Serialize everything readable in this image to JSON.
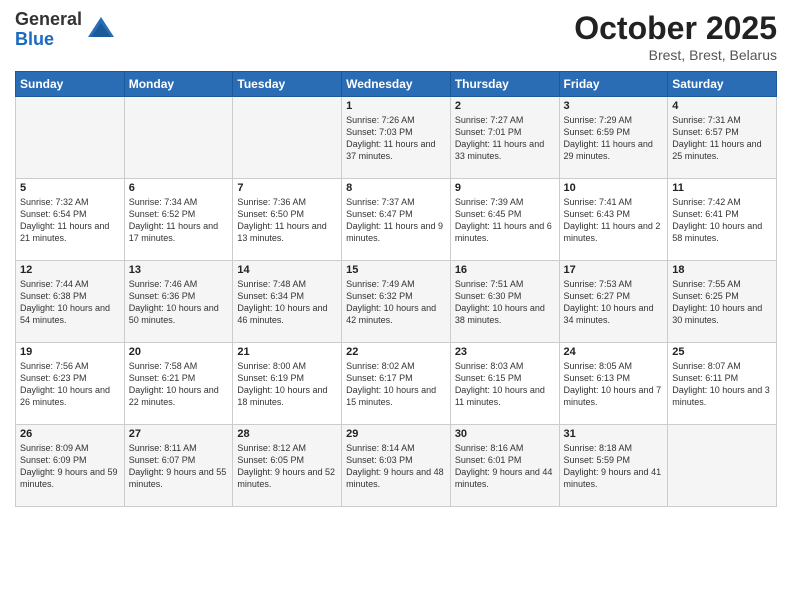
{
  "logo": {
    "general": "General",
    "blue": "Blue"
  },
  "title": "October 2025",
  "subtitle": "Brest, Brest, Belarus",
  "headers": [
    "Sunday",
    "Monday",
    "Tuesday",
    "Wednesday",
    "Thursday",
    "Friday",
    "Saturday"
  ],
  "weeks": [
    [
      {
        "day": "",
        "content": ""
      },
      {
        "day": "",
        "content": ""
      },
      {
        "day": "",
        "content": ""
      },
      {
        "day": "1",
        "content": "Sunrise: 7:26 AM\nSunset: 7:03 PM\nDaylight: 11 hours\nand 37 minutes."
      },
      {
        "day": "2",
        "content": "Sunrise: 7:27 AM\nSunset: 7:01 PM\nDaylight: 11 hours\nand 33 minutes."
      },
      {
        "day": "3",
        "content": "Sunrise: 7:29 AM\nSunset: 6:59 PM\nDaylight: 11 hours\nand 29 minutes."
      },
      {
        "day": "4",
        "content": "Sunrise: 7:31 AM\nSunset: 6:57 PM\nDaylight: 11 hours\nand 25 minutes."
      }
    ],
    [
      {
        "day": "5",
        "content": "Sunrise: 7:32 AM\nSunset: 6:54 PM\nDaylight: 11 hours\nand 21 minutes."
      },
      {
        "day": "6",
        "content": "Sunrise: 7:34 AM\nSunset: 6:52 PM\nDaylight: 11 hours\nand 17 minutes."
      },
      {
        "day": "7",
        "content": "Sunrise: 7:36 AM\nSunset: 6:50 PM\nDaylight: 11 hours\nand 13 minutes."
      },
      {
        "day": "8",
        "content": "Sunrise: 7:37 AM\nSunset: 6:47 PM\nDaylight: 11 hours\nand 9 minutes."
      },
      {
        "day": "9",
        "content": "Sunrise: 7:39 AM\nSunset: 6:45 PM\nDaylight: 11 hours\nand 6 minutes."
      },
      {
        "day": "10",
        "content": "Sunrise: 7:41 AM\nSunset: 6:43 PM\nDaylight: 11 hours\nand 2 minutes."
      },
      {
        "day": "11",
        "content": "Sunrise: 7:42 AM\nSunset: 6:41 PM\nDaylight: 10 hours\nand 58 minutes."
      }
    ],
    [
      {
        "day": "12",
        "content": "Sunrise: 7:44 AM\nSunset: 6:38 PM\nDaylight: 10 hours\nand 54 minutes."
      },
      {
        "day": "13",
        "content": "Sunrise: 7:46 AM\nSunset: 6:36 PM\nDaylight: 10 hours\nand 50 minutes."
      },
      {
        "day": "14",
        "content": "Sunrise: 7:48 AM\nSunset: 6:34 PM\nDaylight: 10 hours\nand 46 minutes."
      },
      {
        "day": "15",
        "content": "Sunrise: 7:49 AM\nSunset: 6:32 PM\nDaylight: 10 hours\nand 42 minutes."
      },
      {
        "day": "16",
        "content": "Sunrise: 7:51 AM\nSunset: 6:30 PM\nDaylight: 10 hours\nand 38 minutes."
      },
      {
        "day": "17",
        "content": "Sunrise: 7:53 AM\nSunset: 6:27 PM\nDaylight: 10 hours\nand 34 minutes."
      },
      {
        "day": "18",
        "content": "Sunrise: 7:55 AM\nSunset: 6:25 PM\nDaylight: 10 hours\nand 30 minutes."
      }
    ],
    [
      {
        "day": "19",
        "content": "Sunrise: 7:56 AM\nSunset: 6:23 PM\nDaylight: 10 hours\nand 26 minutes."
      },
      {
        "day": "20",
        "content": "Sunrise: 7:58 AM\nSunset: 6:21 PM\nDaylight: 10 hours\nand 22 minutes."
      },
      {
        "day": "21",
        "content": "Sunrise: 8:00 AM\nSunset: 6:19 PM\nDaylight: 10 hours\nand 18 minutes."
      },
      {
        "day": "22",
        "content": "Sunrise: 8:02 AM\nSunset: 6:17 PM\nDaylight: 10 hours\nand 15 minutes."
      },
      {
        "day": "23",
        "content": "Sunrise: 8:03 AM\nSunset: 6:15 PM\nDaylight: 10 hours\nand 11 minutes."
      },
      {
        "day": "24",
        "content": "Sunrise: 8:05 AM\nSunset: 6:13 PM\nDaylight: 10 hours\nand 7 minutes."
      },
      {
        "day": "25",
        "content": "Sunrise: 8:07 AM\nSunset: 6:11 PM\nDaylight: 10 hours\nand 3 minutes."
      }
    ],
    [
      {
        "day": "26",
        "content": "Sunrise: 8:09 AM\nSunset: 6:09 PM\nDaylight: 9 hours\nand 59 minutes."
      },
      {
        "day": "27",
        "content": "Sunrise: 8:11 AM\nSunset: 6:07 PM\nDaylight: 9 hours\nand 55 minutes."
      },
      {
        "day": "28",
        "content": "Sunrise: 8:12 AM\nSunset: 6:05 PM\nDaylight: 9 hours\nand 52 minutes."
      },
      {
        "day": "29",
        "content": "Sunrise: 8:14 AM\nSunset: 6:03 PM\nDaylight: 9 hours\nand 48 minutes."
      },
      {
        "day": "30",
        "content": "Sunrise: 8:16 AM\nSunset: 6:01 PM\nDaylight: 9 hours\nand 44 minutes."
      },
      {
        "day": "31",
        "content": "Sunrise: 8:18 AM\nSunset: 5:59 PM\nDaylight: 9 hours\nand 41 minutes."
      },
      {
        "day": "",
        "content": ""
      }
    ]
  ]
}
